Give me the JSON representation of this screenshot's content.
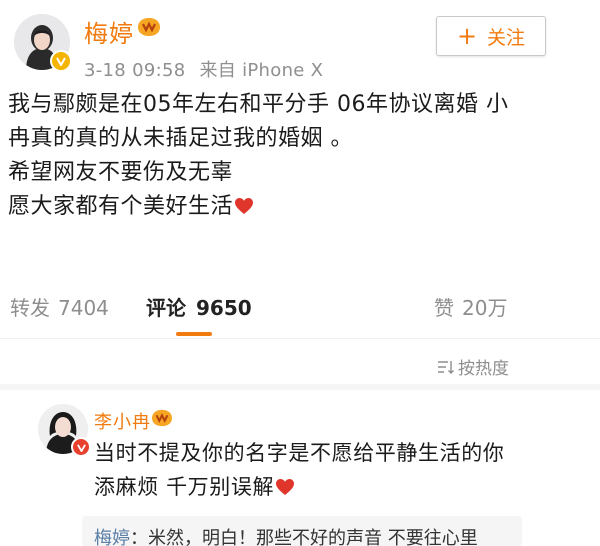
{
  "post": {
    "author": "梅婷",
    "timestamp": "3-18 09:58",
    "source": "来自 iPhone X",
    "follow_label": "关注",
    "lines": [
      "我与鄢颇是在05年左右和平分手  06年协议离婚 小",
      "冉真的真的从未插足过我的婚姻 。",
      "希望网友不要伤及无辜",
      "愿大家都有个美好生活"
    ]
  },
  "actions": {
    "repost_label": "转发",
    "repost_count": "7404",
    "comment_label": "评论",
    "comment_count": "9650",
    "like_label": "赞",
    "like_count": "20万"
  },
  "sort": {
    "label": "按热度"
  },
  "comment": {
    "author": "李小冉",
    "lines": [
      "当时不提及你的名字是不愿给平静生活的你",
      "添麻烦 千万别误解"
    ]
  },
  "reply": {
    "author": "梅婷",
    "text": "：米然，明白！那些不好的声音 不要往心里"
  },
  "icons": {
    "avatar_badge": "verified-v-icon",
    "level_badge": "level-badge-icon",
    "heart": "heart-icon",
    "sort": "sort-icon"
  },
  "colors": {
    "accent": "#f27b0f",
    "heart": "#e0352b",
    "text": "#1b1b1b",
    "muted": "#8e8e8e",
    "reply_name": "#5b7fa6"
  }
}
